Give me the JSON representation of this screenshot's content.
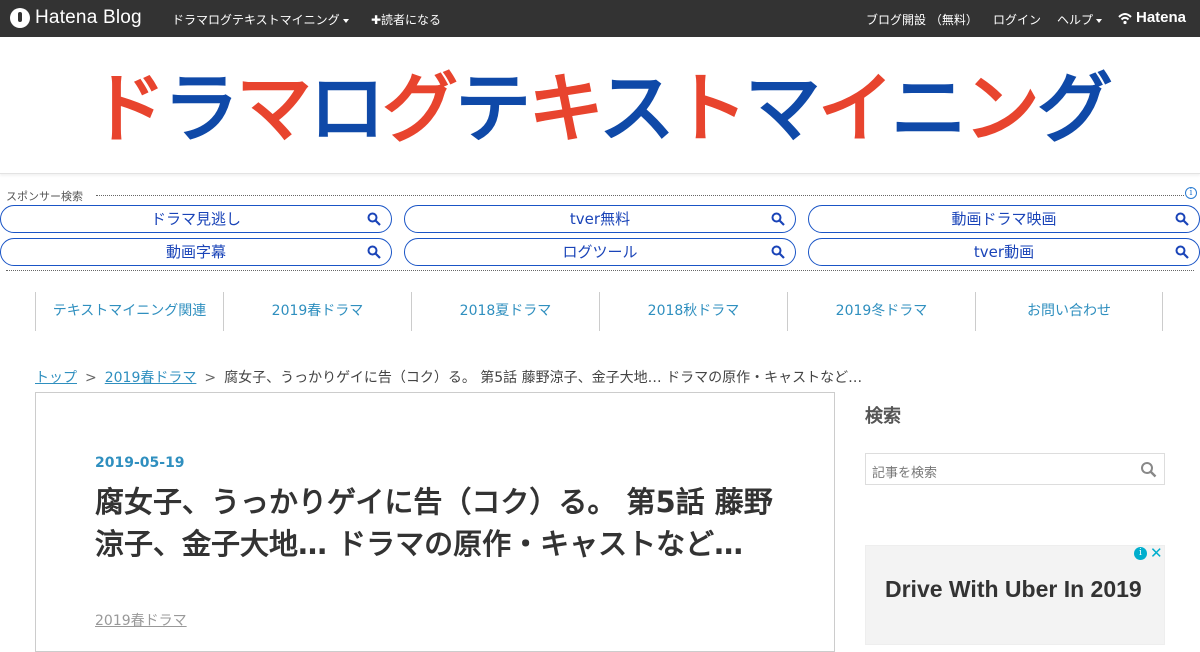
{
  "topbar": {
    "logo_text": "Hatena Blog",
    "blog_menu": "ドラマログテキストマイニング",
    "subscribe": "✚読者になる",
    "start_blog": "ブログ開設 （無料）",
    "login": "ログイン",
    "help": "ヘルプ",
    "hatena": "Hatena"
  },
  "banner": {
    "title": "ドラマログテキストマイニング",
    "colors": [
      "#e8442e",
      "#0f49a8",
      "#e8442e",
      "#0f49a8",
      "#e8442e",
      "#0f49a8",
      "#e8442e",
      "#0f49a8",
      "#e8442e",
      "#0f49a8",
      "#e8442e",
      "#0f49a8",
      "#e8442e",
      "#0f49a8"
    ]
  },
  "sponsor": {
    "label": "スポンサー検索",
    "terms": [
      "ドラマ見逃し",
      "tver無料",
      "動画ドラマ映画",
      "動画字幕",
      "ログツール",
      "tver動画"
    ]
  },
  "categories": [
    "テキストマイニング関連",
    "2019春ドラマ",
    "2018夏ドラマ",
    "2018秋ドラマ",
    "2019冬ドラマ",
    "お問い合わせ"
  ],
  "breadcrumb": {
    "top": "トップ",
    "category": "2019春ドラマ",
    "current": "腐女子、うっかりゲイに告（コク）る。 第5話 藤野涼子、金子大地… ドラマの原作・キャストなど…"
  },
  "article": {
    "date": "2019-05-19",
    "title": "腐女子、うっかりゲイに告（コク）る。 第5話 藤野涼子、金子大地… ドラマの原作・キャストなど…",
    "category": "2019春ドラマ"
  },
  "sidebar": {
    "search_heading": "検索",
    "search_placeholder": "記事を検索",
    "ad_text": "Drive With Uber In 2019"
  }
}
